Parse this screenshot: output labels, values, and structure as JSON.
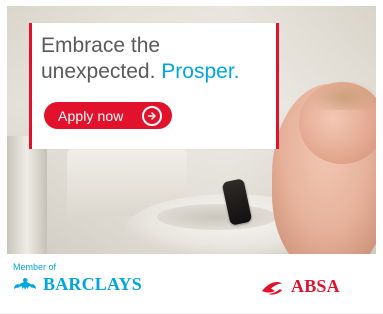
{
  "ad": {
    "headline_line1": "Embrace the",
    "headline_line2_prefix": "unexpected.",
    "headline_line2_highlight": "Prosper.",
    "cta_label": "Apply now"
  },
  "branding": {
    "member_of": "Member of",
    "barclays": "BARCLAYS",
    "absa": "ABSA"
  },
  "colors": {
    "absa_red": "#e3122c",
    "barclays_blue": "#00a6e0",
    "headline_gray": "#5a5a5a"
  },
  "icons": {
    "cta_arrow": "arrow-right-circle-icon",
    "barclays_logo": "barclays-eagle-icon",
    "absa_logo": "absa-logo-icon"
  }
}
